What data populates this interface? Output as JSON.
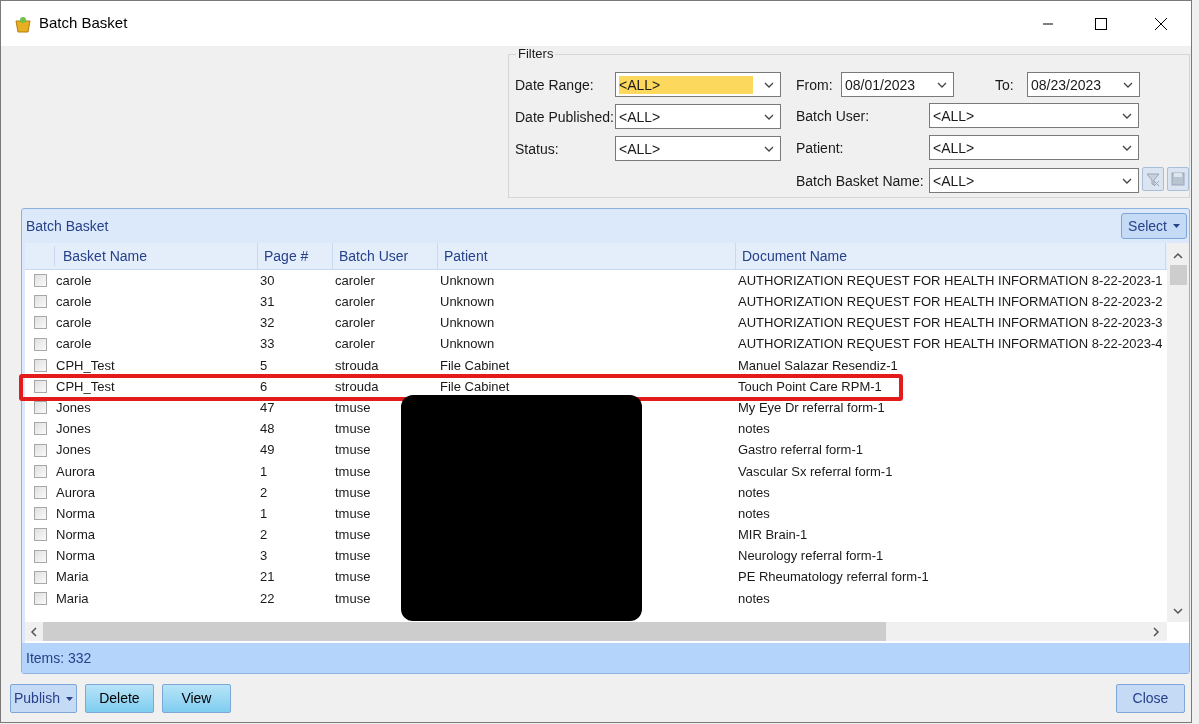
{
  "window": {
    "title": "Batch Basket"
  },
  "filters": {
    "title": "Filters",
    "fields": [
      {
        "label": "Date Range:",
        "value": "<ALL>",
        "focused": true
      },
      {
        "label": "From:",
        "value": "08/01/2023",
        "focused": false
      },
      {
        "label": "To:",
        "value": "08/23/2023",
        "focused": false
      },
      {
        "label": "Date Published:",
        "value": "<ALL>",
        "focused": false
      },
      {
        "label": "Batch User:",
        "value": "<ALL>",
        "focused": false
      },
      {
        "label": "Status:",
        "value": "<ALL>",
        "focused": false
      },
      {
        "label": "Patient:",
        "value": "<ALL>",
        "focused": false
      },
      {
        "label": "Batch Basket Name:",
        "value": "<ALL>",
        "focused": false
      }
    ]
  },
  "panel": {
    "title": "Batch Basket",
    "select_button": "Select",
    "columns": [
      "Basket Name",
      "Page #",
      "Batch User",
      "Patient",
      "Document Name"
    ],
    "rows": [
      {
        "outlined": false,
        "checked": false,
        "basket_name": "carole",
        "page": "30",
        "batch_user": "caroler",
        "patient": "Unknown",
        "document_name": "AUTHORIZATION REQUEST FOR HEALTH INFORMATION  8-22-2023-1"
      },
      {
        "outlined": false,
        "checked": false,
        "basket_name": "carole",
        "page": "31",
        "batch_user": "caroler",
        "patient": "Unknown",
        "document_name": "AUTHORIZATION REQUEST FOR HEALTH INFORMATION  8-22-2023-2"
      },
      {
        "outlined": false,
        "checked": false,
        "basket_name": "carole",
        "page": "32",
        "batch_user": "caroler",
        "patient": "Unknown",
        "document_name": "AUTHORIZATION REQUEST FOR HEALTH INFORMATION  8-22-2023-3"
      },
      {
        "outlined": false,
        "checked": false,
        "basket_name": "carole",
        "page": "33",
        "batch_user": "caroler",
        "patient": "Unknown",
        "document_name": "AUTHORIZATION REQUEST FOR HEALTH INFORMATION  8-22-2023-4"
      },
      {
        "outlined": false,
        "checked": false,
        "basket_name": "CPH_Test",
        "page": "5",
        "batch_user": "strouda",
        "patient": "File Cabinet",
        "document_name": "Manuel Salazar Resendiz-1"
      },
      {
        "outlined": true,
        "checked": false,
        "basket_name": "CPH_Test",
        "page": "6",
        "batch_user": "strouda",
        "patient": "File Cabinet",
        "document_name": "Touch Point Care RPM-1"
      },
      {
        "outlined": false,
        "checked": false,
        "basket_name": "Jones",
        "page": "47",
        "batch_user": "tmuse",
        "document_name": "My Eye Dr referral form-1"
      },
      {
        "outlined": false,
        "checked": false,
        "basket_name": "Jones",
        "page": "48",
        "batch_user": "tmuse",
        "document_name": "notes"
      },
      {
        "outlined": false,
        "checked": false,
        "basket_name": "Jones",
        "page": "49",
        "batch_user": "tmuse",
        "document_name": "Gastro referral form-1"
      },
      {
        "outlined": false,
        "checked": false,
        "basket_name": "Aurora",
        "page": "1",
        "batch_user": "tmuse",
        "document_name": "Vascular Sx referral form-1"
      },
      {
        "outlined": false,
        "checked": false,
        "basket_name": "Aurora",
        "page": "2",
        "batch_user": "tmuse",
        "document_name": "notes"
      },
      {
        "outlined": false,
        "checked": false,
        "basket_name": "Norma",
        "page": "1",
        "batch_user": "tmuse",
        "document_name": "notes"
      },
      {
        "outlined": false,
        "checked": false,
        "basket_name": "Norma",
        "page": "2",
        "batch_user": "tmuse",
        "document_name": "MIR Brain-1"
      },
      {
        "outlined": false,
        "checked": false,
        "basket_name": "Norma",
        "page": "3",
        "batch_user": "tmuse",
        "document_name": "Neurology referral form-1"
      },
      {
        "outlined": false,
        "checked": false,
        "basket_name": "Maria",
        "page": "21",
        "batch_user": "tmuse",
        "document_name": "PE Rheumatology referral form-1"
      },
      {
        "outlined": false,
        "checked": false,
        "basket_name": "Maria",
        "page": "22",
        "batch_user": "tmuse",
        "document_name": "notes"
      }
    ],
    "status": "Items: 332"
  },
  "buttons": [
    {
      "label": "Publish",
      "kind": "dropdown"
    },
    {
      "label": "Delete",
      "kind": "plain"
    },
    {
      "label": "View",
      "kind": "plain"
    }
  ],
  "close_button": "Close"
}
